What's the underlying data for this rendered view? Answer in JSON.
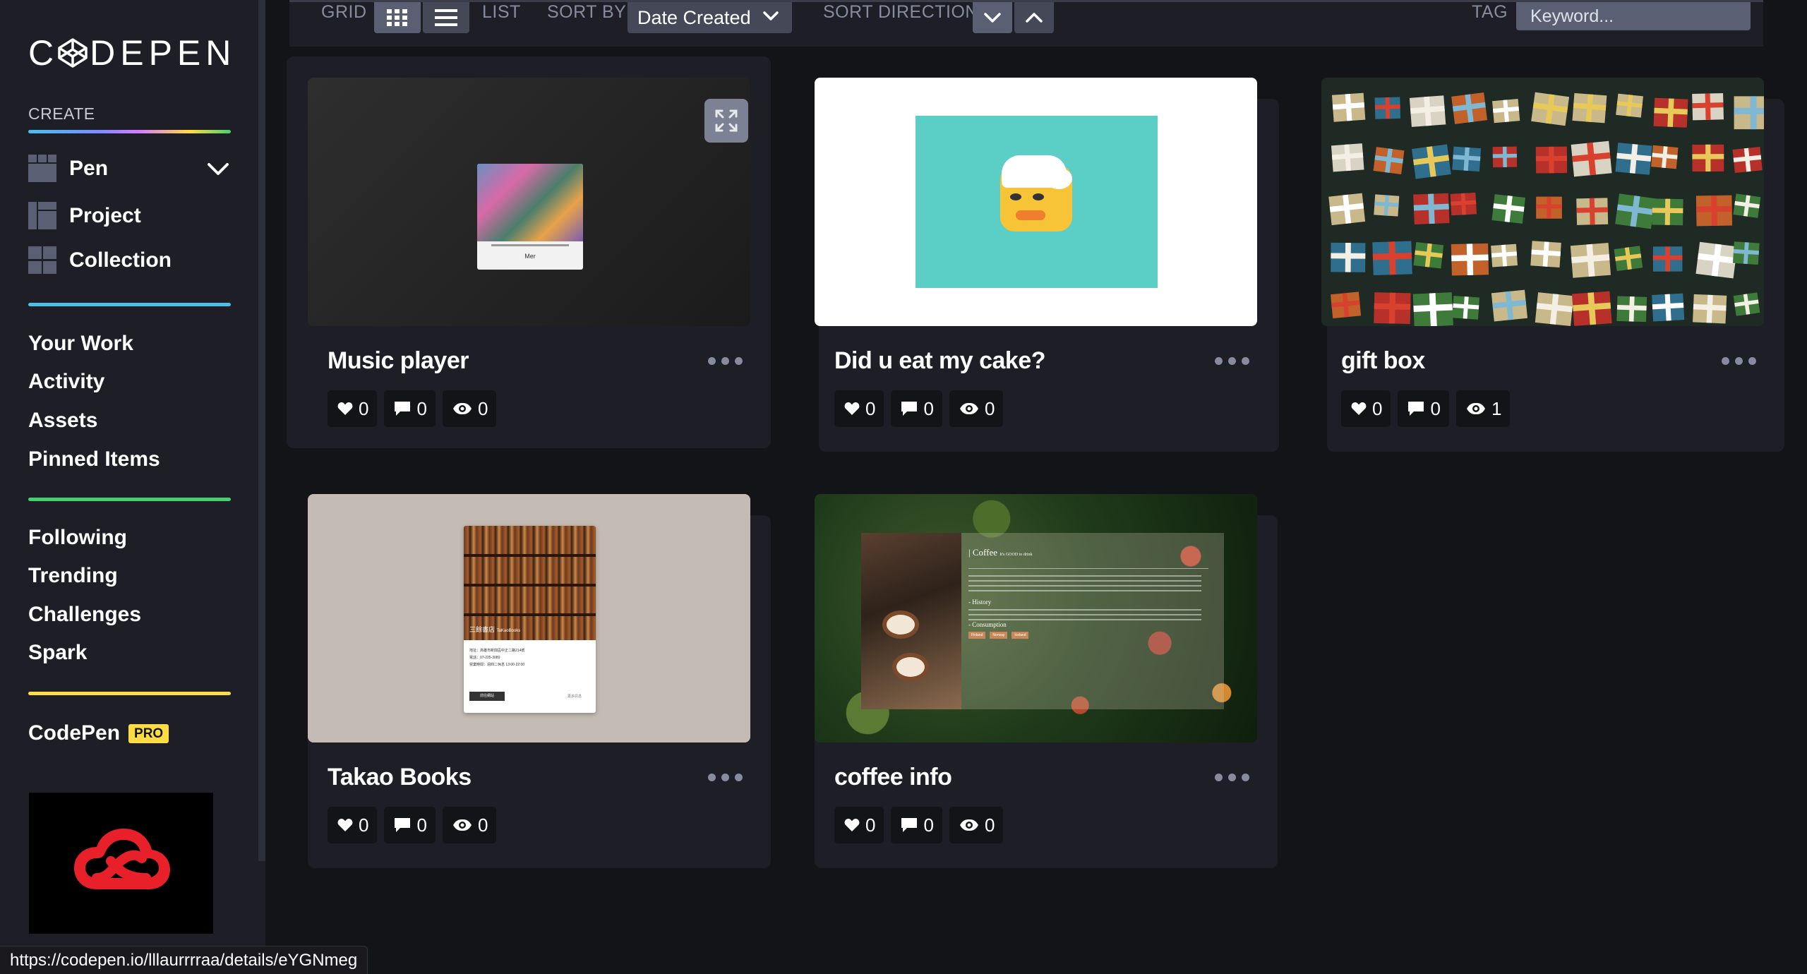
{
  "brand": {
    "logo_text_left": "C",
    "logo_text_right": "DEPEN"
  },
  "sidebar": {
    "create_label": "CREATE",
    "create_items": [
      {
        "label": "Pen",
        "icon": "pen-grid-icon"
      },
      {
        "label": "Project",
        "icon": "project-icon"
      },
      {
        "label": "Collection",
        "icon": "collection-icon"
      }
    ],
    "group1": [
      "Your Work",
      "Activity",
      "Assets",
      "Pinned Items"
    ],
    "group2": [
      "Following",
      "Trending",
      "Challenges",
      "Spark"
    ],
    "pro_label": "CodePen",
    "pro_badge": "PRO",
    "ad_icon": "adobe-creative-cloud-icon"
  },
  "filterbar": {
    "grid_label": "GRID",
    "list_label": "LIST",
    "sort_by_label": "SORT BY",
    "sort_by_value": "Date Created",
    "sort_direction_label": "SORT DIRECTION",
    "tag_label": "TAG",
    "tag_placeholder": "Keyword..."
  },
  "cards": [
    {
      "title": "Music player",
      "likes": "0",
      "comments": "0",
      "views": "0",
      "thumb_caption": "Mer"
    },
    {
      "title": "Did u eat my cake?",
      "likes": "0",
      "comments": "0",
      "views": "0"
    },
    {
      "title": "gift box",
      "likes": "0",
      "comments": "0",
      "views": "1"
    },
    {
      "title": "Takao Books",
      "likes": "0",
      "comments": "0",
      "views": "0",
      "thumb_caption": "三餘書店",
      "thumb_caption_en": "TaKaoBooks",
      "thumb_lines": [
        "地址：高雄市新興區中正二路214號",
        "電話：07-225-3080",
        "營業時間：週四二休息 13:00-22:00"
      ],
      "thumb_button": "前往網站",
      "thumb_more": "更多訊息"
    },
    {
      "title": "coffee info",
      "likes": "0",
      "comments": "0",
      "views": "0",
      "thumb_heading": "| Coffee",
      "thumb_tagline": "It's GOOD to drink",
      "thumb_sections": [
        "- History",
        "- Consumption"
      ],
      "thumb_tags": [
        "Finland",
        "Norway",
        "Iceland"
      ]
    }
  ],
  "status_url": "https://codepen.io/lllaurrrraa/details/eYGNmeg",
  "colors": {
    "accent_blue": "#4bbfe9",
    "accent_green": "#47cf73",
    "accent_yellow": "#ffdd40",
    "bg": "#131417",
    "panel": "#1e1f26"
  }
}
